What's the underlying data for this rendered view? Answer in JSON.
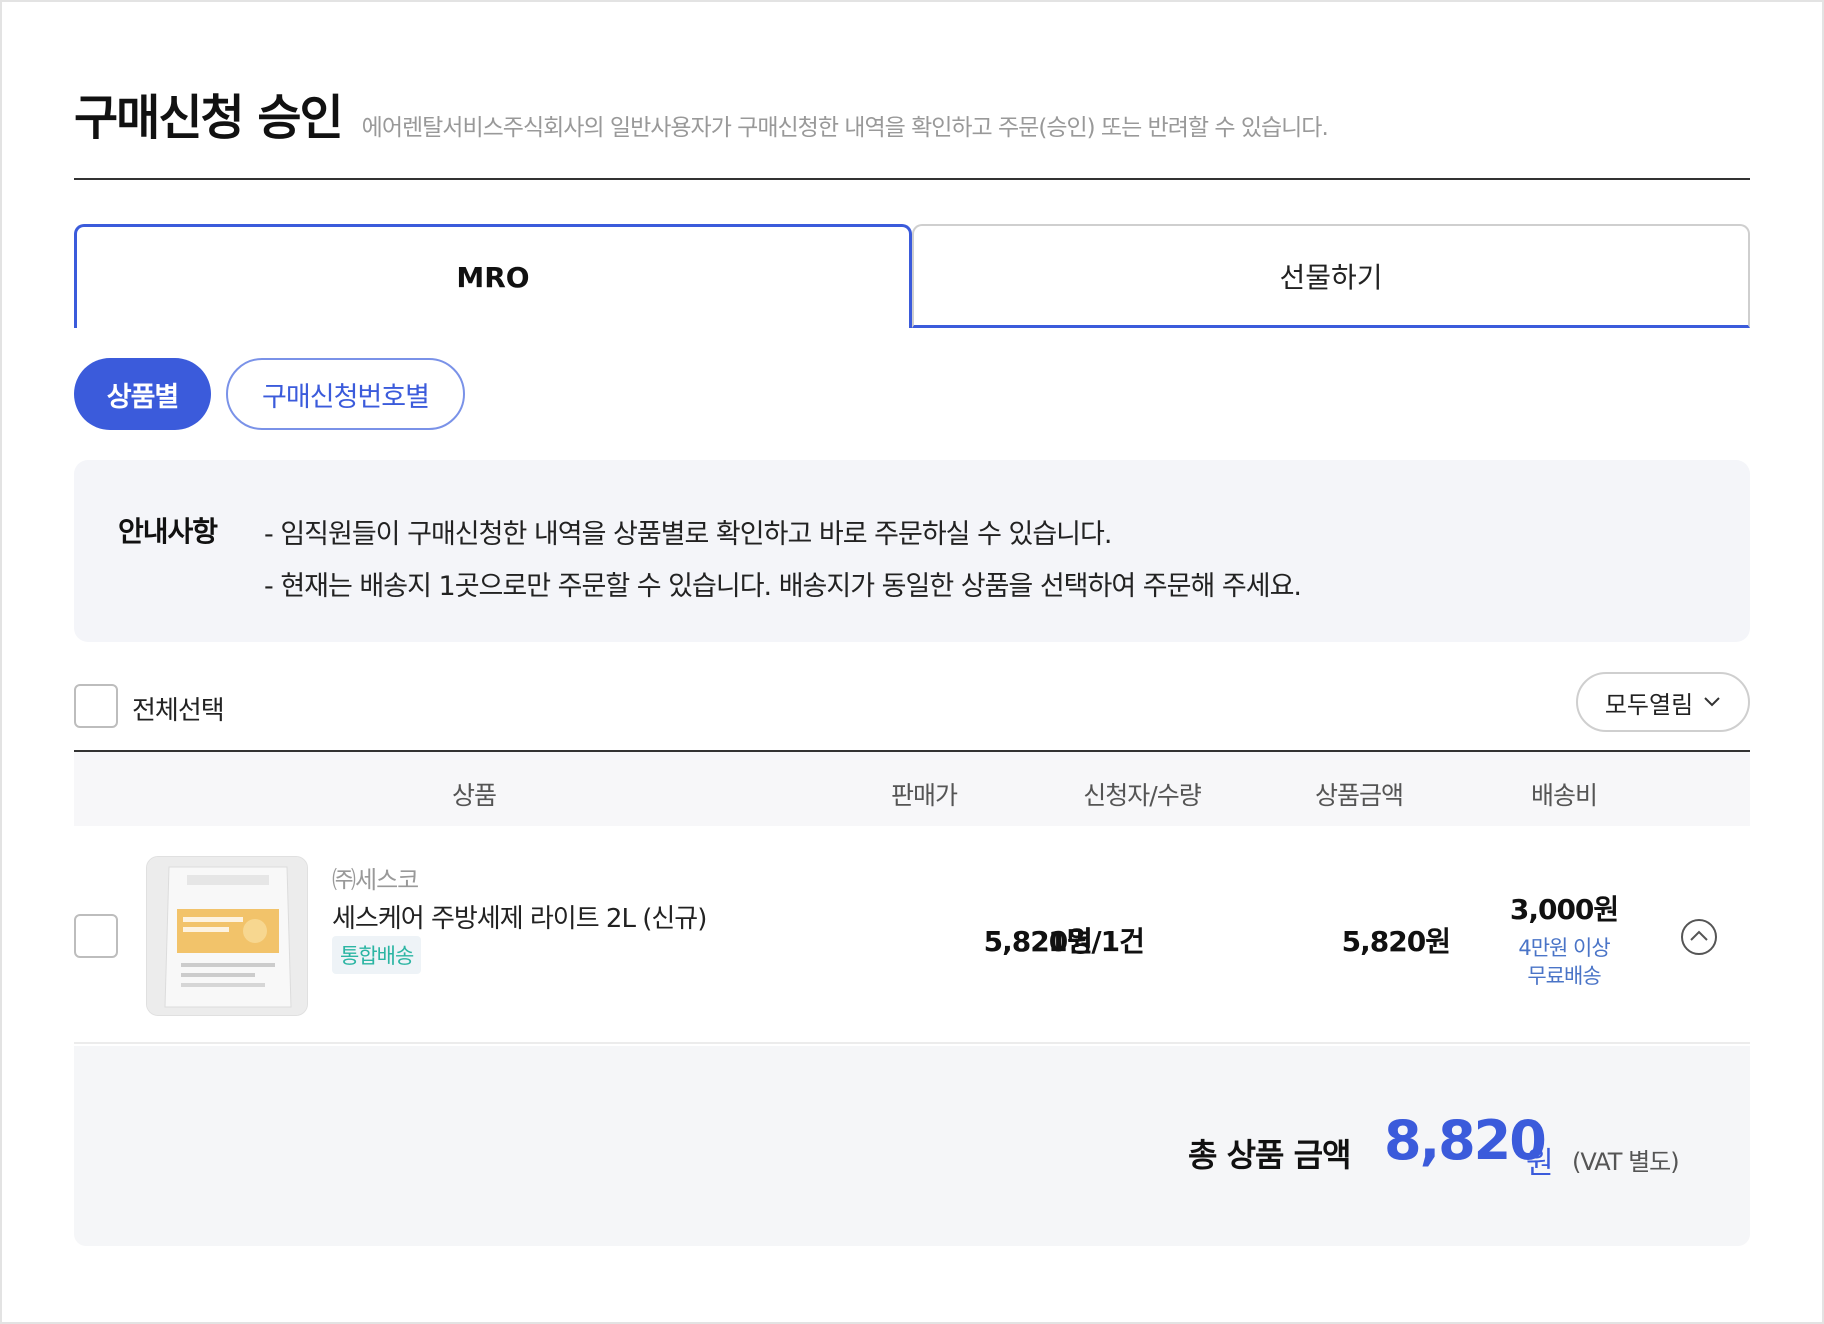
{
  "header": {
    "title": "구매신청 승인",
    "description": "에어렌탈서비스주식회사의 일반사용자가 구매신청한 내역을 확인하고 주문(승인) 또는 반려할 수 있습니다."
  },
  "tabs": [
    {
      "label": "MRO",
      "active": true
    },
    {
      "label": "선물하기",
      "active": false
    }
  ],
  "view_toggle": {
    "by_product": "상품별",
    "by_request_number": "구매신청번호별",
    "selected": "상품별"
  },
  "notice": {
    "title": "안내사항",
    "lines": [
      "- 임직원들이 구매신청한 내역을 상품별로 확인하고 바로 주문하실 수 있습니다.",
      "- 현재는 배송지 1곳으로만 주문할 수 있습니다. 배송지가 동일한 상품을 선택하여 주문해 주세요."
    ]
  },
  "controls": {
    "select_all_label": "전체선택",
    "expand_all_label": "모두열림"
  },
  "table": {
    "headers": [
      "상품",
      "판매가",
      "신청자/수량",
      "상품금액",
      "배송비"
    ],
    "rows": [
      {
        "brand": "㈜세스코",
        "name": "세스케어 주방세제 라이트 2L (신규)",
        "badge": "통합배송",
        "price": "5,820원",
        "qty": "1명/1건",
        "amount": "5,820원",
        "shipping_fee": "3,000원",
        "shipping_note_1": "4만원 이상",
        "shipping_note_2": "무료배송"
      }
    ]
  },
  "total": {
    "label": "총 상품 금액",
    "value": "8,820",
    "unit": "원",
    "vat_note": "(VAT 별도)"
  },
  "colors": {
    "accent": "#3b5bdb",
    "badge_text": "#2bb5a3",
    "shipping_note": "#4a74c7"
  },
  "icons": {
    "expand": "chevron-down-icon",
    "collapse": "chevron-up-circle-icon"
  }
}
